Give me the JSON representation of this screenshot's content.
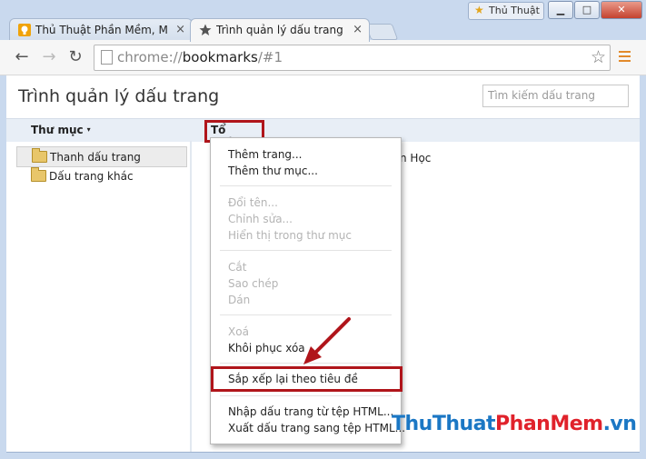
{
  "window": {
    "profile_name": "Thủ Thuật",
    "minimize_label": "▁",
    "maximize_label": "□",
    "close_label": "✕"
  },
  "tabs": [
    {
      "label": "Thủ Thuật Phần Mềm, Má",
      "icon": "bulb-favicon-icon",
      "close": "×"
    },
    {
      "label": "Trình quản lý dấu trang",
      "icon": "star-favicon-icon",
      "close": "×"
    }
  ],
  "toolbar": {
    "back": "←",
    "forward": "→",
    "reload": "↻",
    "url_prefix": "chrome://",
    "url_host": "bookmarks",
    "url_suffix": "/#1",
    "bookmark_star": "☆"
  },
  "page": {
    "title": "Trình quản lý dấu trang",
    "search_placeholder": "Tìm kiếm dấu trang"
  },
  "header": {
    "folders_label": "Thư mục",
    "organize_label": "Tổ chức",
    "caret": "▾"
  },
  "sidebar": {
    "items": [
      {
        "label": "Thanh dấu trang",
        "selected": true
      },
      {
        "label": "Dấu trang khác",
        "selected": false
      }
    ]
  },
  "list": {
    "partial_text": "n Học"
  },
  "organize_menu": {
    "group1": [
      "Thêm trang...",
      "Thêm thư mục..."
    ],
    "group2": [
      "Đổi tên...",
      "Chỉnh sửa...",
      "Hiển thị trong thư mục"
    ],
    "group3": [
      "Cắt",
      "Sao chép",
      "Dán"
    ],
    "group4": [
      "Xoá",
      "Khôi phục xóa"
    ],
    "group5": [
      "Sắp xếp lại theo tiêu đề"
    ],
    "group6": [
      "Nhập dấu trang từ tệp HTML...",
      "Xuất dấu trang sang tệp HTML..."
    ]
  },
  "watermark": {
    "part1": "ThuThuat",
    "part2": "PhanMem",
    "part3": ".vn"
  },
  "colors": {
    "highlight_red": "#b0151b",
    "menu_icon_orange": "#e28a2b",
    "frame_blue": "#c9d9ee"
  }
}
